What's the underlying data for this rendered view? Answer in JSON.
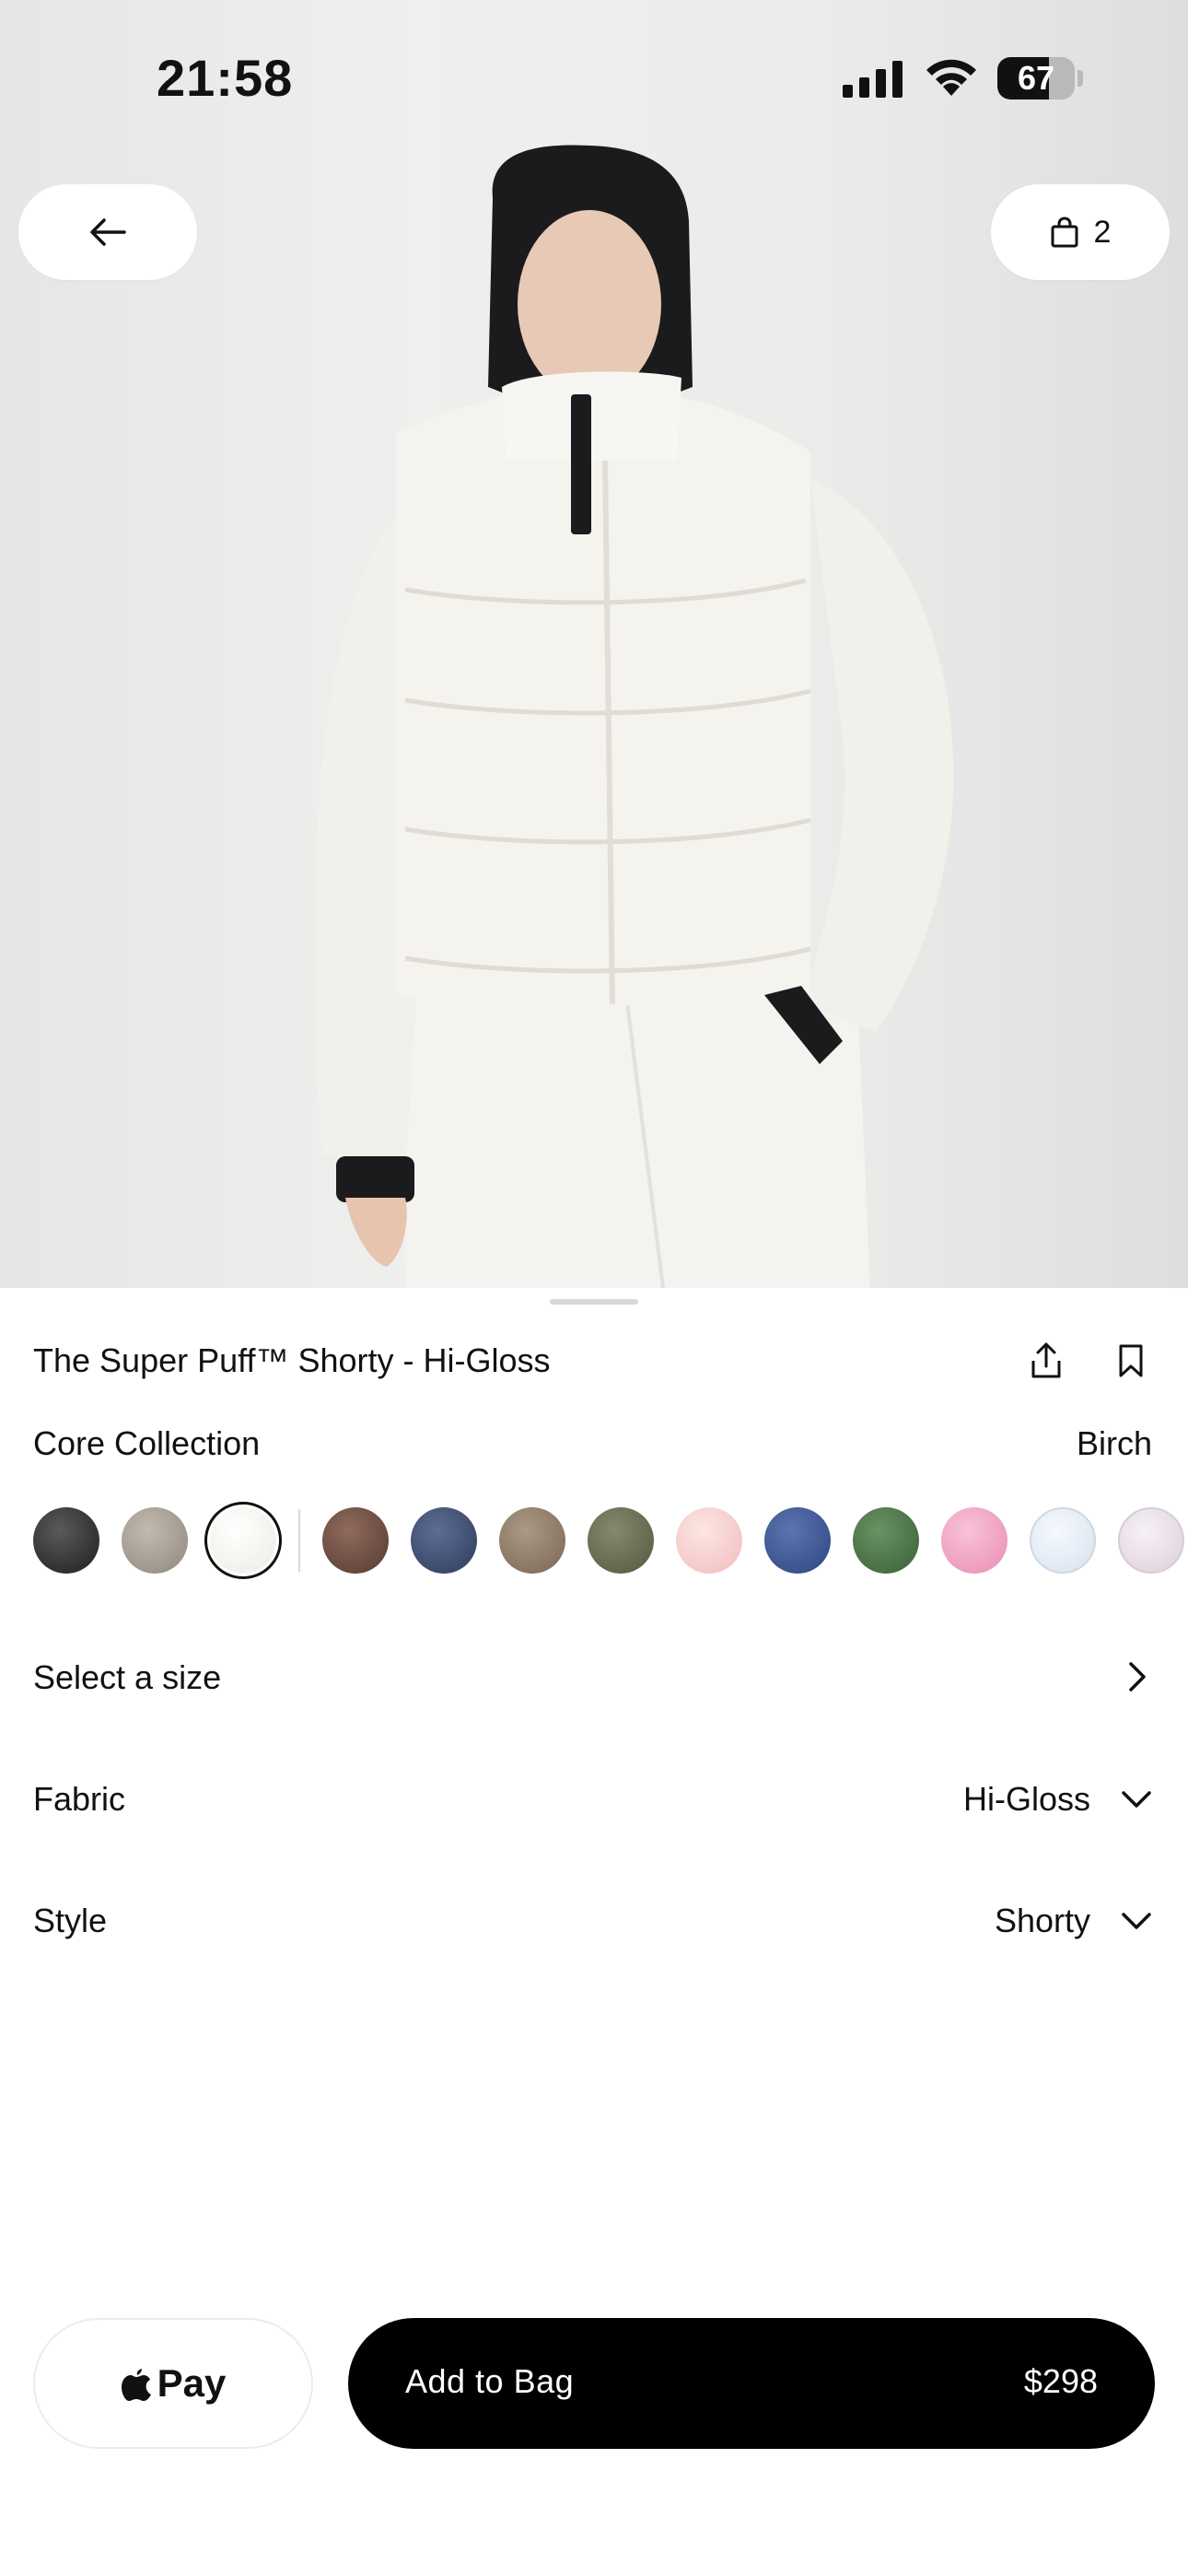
{
  "status_bar": {
    "time": "21:58",
    "battery_level": "67"
  },
  "header": {
    "bag_count": "2"
  },
  "product": {
    "title": "The Super Puff™ Shorty - Hi-Gloss",
    "collection": "Core Collection",
    "selected_color": "Birch",
    "swatches": [
      {
        "name": "black",
        "color": "#2a2a2a"
      },
      {
        "name": "taupe",
        "color": "#a39b8f"
      },
      {
        "name": "birch",
        "color": "#f4f2ea",
        "selected": true
      },
      {
        "name": "brown",
        "color": "#6b4a3d"
      },
      {
        "name": "navy",
        "color": "#3c4b6e"
      },
      {
        "name": "mocha",
        "color": "#8e7a66"
      },
      {
        "name": "olive",
        "color": "#686a52"
      },
      {
        "name": "blush",
        "color": "#f6d0cf"
      },
      {
        "name": "blue",
        "color": "#3b5391"
      },
      {
        "name": "green",
        "color": "#4a7346"
      },
      {
        "name": "pink",
        "color": "#f2a3c4"
      },
      {
        "name": "ice",
        "color": "#e7eff8"
      },
      {
        "name": "lilac",
        "color": "#ece1ea"
      }
    ]
  },
  "options": {
    "size_label": "Select a size",
    "fabric_label": "Fabric",
    "fabric_value": "Hi-Gloss",
    "style_label": "Style",
    "style_value": "Shorty"
  },
  "footer": {
    "apple_pay_label": "Pay",
    "add_to_bag_label": "Add to Bag",
    "price": "$298"
  },
  "colors": {
    "accent": "#000000",
    "background": "#ffffff",
    "hero_bg": "#ebebea"
  }
}
